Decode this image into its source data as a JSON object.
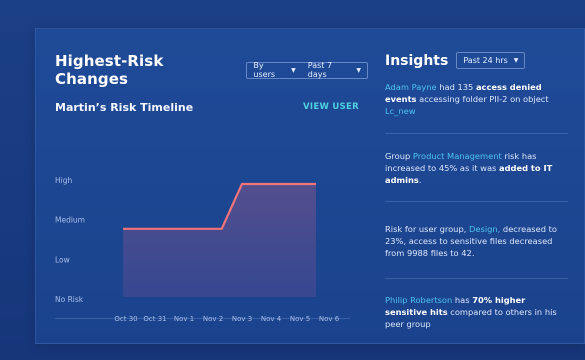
{
  "risk_changes": {
    "title": "Highest-Risk Changes",
    "filter_group": {
      "label": "By users"
    },
    "filter_range": {
      "label": "Past 7 days"
    },
    "timeline_title": "Martin’s Risk Timeline",
    "view_user_label": "VIEW USER"
  },
  "chart_data": {
    "type": "area",
    "title": "",
    "xlabel": "",
    "ylabel": "",
    "y_levels": [
      "No Risk",
      "Low",
      "Medium",
      "High"
    ],
    "x": [
      "Oct 30",
      "Oct 31",
      "Nov 1",
      "Nov 2",
      "Nov 3",
      "Nov 4",
      "Nov 5",
      "Nov 6"
    ],
    "series": [
      {
        "values": [
          1.77,
          1.77,
          1.77,
          1.77,
          1.77,
          2.9,
          2.9,
          2.9,
          2.9
        ]
      }
    ],
    "series_x_positions": [
      -0.1,
      0.5,
      1.5,
      2.5,
      3.3,
      4.0,
      5.0,
      6.0,
      6.55
    ],
    "ylim": [
      0,
      3
    ],
    "grid": false,
    "line_color": "#f0747a",
    "fill_color": "#5a4f8e"
  },
  "insights": {
    "title": "Insights",
    "range_label": "Past 24 hrs",
    "items": [
      {
        "user": "Adam Payne",
        "t1": " had 135 ",
        "bold": "access denied events",
        "t2": " accessing folder PII-2 on object ",
        "link": "Lc_new"
      },
      {
        "pre": "Group ",
        "group": "Product Management",
        "t1": " risk has increased to 45% as it was ",
        "bold": "added to IT admins",
        "t2": "."
      },
      {
        "pre": "Risk for user group, ",
        "group": "Design,",
        "t1": " decreased to 23%, access to sensitive files decreased from 9988 files to 42."
      },
      {
        "user": "Philip Robertson",
        "t1": " has ",
        "bold": "70% higher sensitive hits",
        "t2": " compared to others in his peer group"
      }
    ]
  },
  "colors": {
    "background": "#1b3f86",
    "card": "#1f4a97",
    "accent_teal": "#4fd0e0",
    "link_blue": "#4cc3f0",
    "line": "#f0747a"
  }
}
